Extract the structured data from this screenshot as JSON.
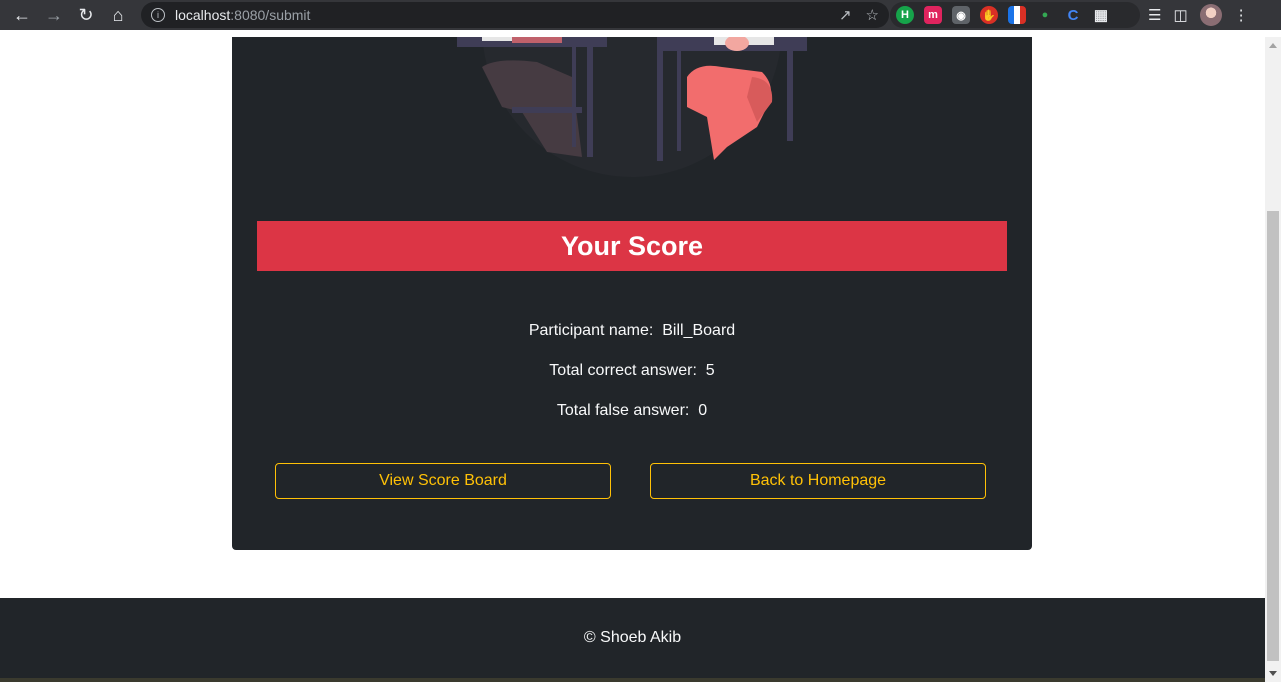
{
  "browser": {
    "url_host": "localhost",
    "url_rest": ":8080/submit"
  },
  "page": {
    "score_title": "Your Score",
    "participant_label": "Participant name:",
    "participant_value": "Bill_Board",
    "correct_label": "Total correct answer:",
    "correct_value": "5",
    "false_label": "Total false answer:",
    "false_value": "0",
    "view_scoreboard_label": "View Score Board",
    "back_home_label": "Back to Homepage"
  },
  "footer": {
    "copyright": "© Shoeb Akib"
  },
  "colors": {
    "card_bg": "#212529",
    "banner": "#dc3545",
    "button_accent": "#ffc107"
  }
}
